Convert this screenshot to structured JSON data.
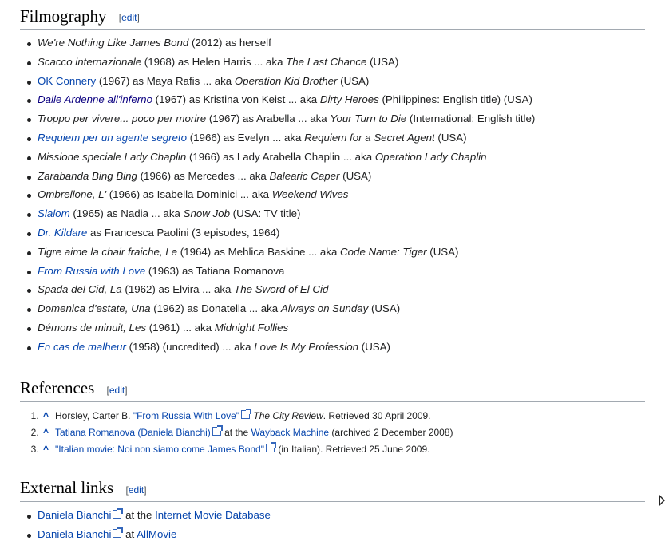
{
  "edit_label": "edit",
  "filmography": {
    "heading": "Filmography",
    "items": [
      {
        "title": "We're Nothing Like James Bond",
        "rest": " (2012) as herself",
        "aka": "",
        "aka_suffix": ""
      },
      {
        "title": "Scacco internazionale",
        "rest": " (1968) as Helen Harris ... aka ",
        "aka": "The Last Chance",
        "aka_suffix": " (USA)"
      },
      {
        "title": "OK Connery",
        "rest": " (1967) as Maya Rafis ... aka ",
        "aka": "Operation Kid Brother",
        "aka_suffix": " (USA)"
      },
      {
        "title": "Dalle Ardenne all'inferno",
        "rest": " (1967) as Kristina von Keist ... aka ",
        "aka": "Dirty Heroes",
        "aka_suffix": " (Philippines: English title) (USA)"
      },
      {
        "title": "Troppo per vivere... poco per morire",
        "rest": " (1967) as Arabella ... aka ",
        "aka": "Your Turn to Die",
        "aka_suffix": " (International: English title)"
      },
      {
        "title": "Requiem per un agente segreto",
        "rest": " (1966) as Evelyn ... aka ",
        "aka": "Requiem for a Secret Agent",
        "aka_suffix": " (USA)"
      },
      {
        "title": "Missione speciale Lady Chaplin",
        "rest": " (1966) as Lady Arabella Chaplin ... aka ",
        "aka": "Operation Lady Chaplin",
        "aka_suffix": ""
      },
      {
        "title": "Zarabanda Bing Bing",
        "rest": " (1966) as Mercedes ... aka ",
        "aka": "Balearic Caper",
        "aka_suffix": " (USA)"
      },
      {
        "title": "Ombrellone, L'",
        "rest": " (1966) as Isabella Dominici ... aka ",
        "aka": "Weekend Wives",
        "aka_suffix": ""
      },
      {
        "title": "Slalom",
        "rest": " (1965) as Nadia ... aka ",
        "aka": "Snow Job",
        "aka_suffix": " (USA: TV title)"
      },
      {
        "title": "Dr. Kildare",
        "rest": " as Francesca Paolini (3 episodes, 1964)",
        "aka": "",
        "aka_suffix": ""
      },
      {
        "title": "Tigre aime la chair fraiche, Le",
        "rest": " (1964) as Mehlica Baskine ... aka ",
        "aka": "Code Name: Tiger",
        "aka_suffix": " (USA)"
      },
      {
        "title": "From Russia with Love",
        "rest": " (1963) as Tatiana Romanova",
        "aka": "",
        "aka_suffix": ""
      },
      {
        "title": "Spada del Cid, La",
        "rest": " (1962) as Elvira ... aka ",
        "aka": "The Sword of El Cid",
        "aka_suffix": ""
      },
      {
        "title": "Domenica d'estate, Una",
        "rest": " (1962) as Donatella ... aka ",
        "aka": "Always on Sunday",
        "aka_suffix": " (USA)"
      },
      {
        "title": "Démons de minuit, Les",
        "rest": " (1961) ... aka ",
        "aka": "Midnight Follies",
        "aka_suffix": ""
      },
      {
        "title": "En cas de malheur",
        "rest": " (1958) (uncredited) ... aka ",
        "aka": "Love Is My Profession",
        "aka_suffix": " (USA)"
      }
    ]
  },
  "references": {
    "heading": "References",
    "items": [
      {
        "caret": "^",
        "pre": "Horsley, Carter B. ",
        "link": "\"From Russia With Love\"",
        "mid_italic": "The City Review",
        "post": ". Retrieved 30 April 2009."
      },
      {
        "caret": "^",
        "link": "Tatiana Romanova (Daniela Bianchi)",
        "mid": " at the ",
        "link2": "Wayback Machine",
        "post": " (archived 2 December 2008)"
      },
      {
        "caret": "^",
        "link": "\"Italian movie: Noi non siamo come James Bond\"",
        "post": " (in Italian). Retrieved 25 June 2009."
      }
    ]
  },
  "external_links": {
    "heading": "External links",
    "items": [
      {
        "link": "Daniela Bianchi",
        "mid": " at the ",
        "link2": "Internet Movie Database"
      },
      {
        "link": "Daniela Bianchi",
        "mid": " at ",
        "link2": "AllMovie"
      }
    ]
  },
  "colors": {
    "link": "#0645ad",
    "visited_link": "#0b0080",
    "text": "#202122",
    "rule": "#a2a9b1"
  }
}
